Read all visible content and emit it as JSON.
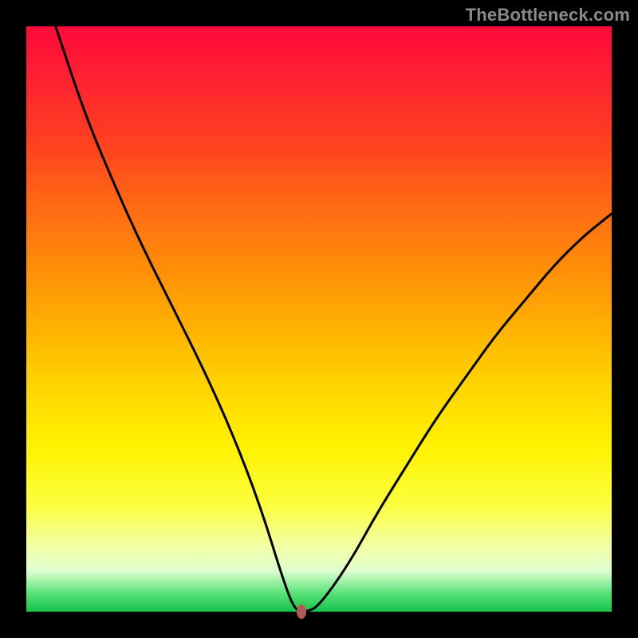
{
  "watermark": "TheBottleneck.com",
  "chart_data": {
    "type": "line",
    "title": "",
    "xlabel": "",
    "ylabel": "",
    "xlim": [
      0,
      100
    ],
    "ylim": [
      0,
      100
    ],
    "series": [
      {
        "name": "bottleneck-curve",
        "x": [
          5,
          10,
          15,
          20,
          25,
          30,
          35,
          40,
          44,
          46,
          48,
          50,
          55,
          60,
          65,
          70,
          75,
          80,
          85,
          90,
          95,
          100
        ],
        "y": [
          100,
          85,
          73,
          62,
          52,
          42,
          31,
          18,
          5,
          0,
          0,
          1,
          8,
          17,
          25,
          33,
          40,
          47,
          53,
          59,
          64,
          68
        ]
      }
    ],
    "marker": {
      "x": 47,
      "y": 0,
      "color": "#b05a5a"
    },
    "gradient_stops": [
      {
        "pos": 0,
        "color": "#ff0a3a"
      },
      {
        "pos": 50,
        "color": "#ffd600"
      },
      {
        "pos": 85,
        "color": "#f5ff9c"
      },
      {
        "pos": 100,
        "color": "#17c24b"
      }
    ]
  }
}
